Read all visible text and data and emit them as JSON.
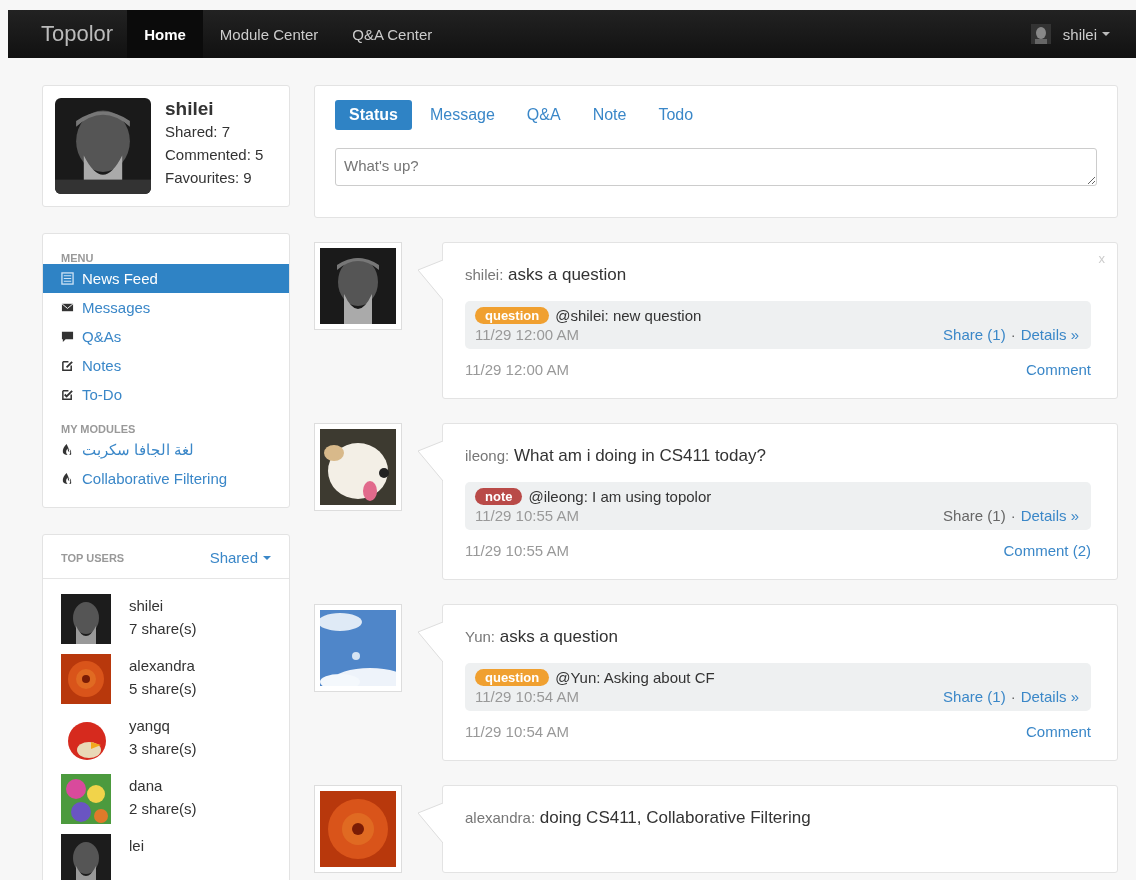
{
  "navbar": {
    "brand": "Topolor",
    "links": [
      {
        "label": "Home",
        "selected": true
      },
      {
        "label": "Module Center",
        "selected": false
      },
      {
        "label": "Q&A Center",
        "selected": false
      }
    ],
    "user": "shilei"
  },
  "profile": {
    "name": "shilei",
    "stats": [
      "Shared: 7",
      "Commented: 5",
      "Favourites: 9"
    ]
  },
  "menu": {
    "heading": "MENU",
    "items": [
      {
        "label": "News Feed",
        "selected": true
      },
      {
        "label": "Messages",
        "selected": false
      },
      {
        "label": "Q&As",
        "selected": false
      },
      {
        "label": "Notes",
        "selected": false
      },
      {
        "label": "To-Do",
        "selected": false
      }
    ],
    "modules_heading": "MY MODULES",
    "modules": [
      {
        "label": "لغة الجافا سكربت"
      },
      {
        "label": "Collaborative Filtering"
      }
    ]
  },
  "top_users": {
    "heading": "TOP USERS",
    "sort": "Shared",
    "users": [
      {
        "name": "shilei",
        "count": "7 share(s)"
      },
      {
        "name": "alexandra",
        "count": "5 share(s)"
      },
      {
        "name": "yangq",
        "count": "3 share(s)"
      },
      {
        "name": "dana",
        "count": "2 share(s)"
      },
      {
        "name": "lei"
      }
    ]
  },
  "composer": {
    "tabs": [
      {
        "label": "Status",
        "selected": true
      },
      {
        "label": "Message",
        "selected": false
      },
      {
        "label": "Q&A",
        "selected": false
      },
      {
        "label": "Note",
        "selected": false
      },
      {
        "label": "Todo",
        "selected": false
      }
    ],
    "placeholder": "What's up?"
  },
  "posts": [
    {
      "user": "shilei:",
      "text": "asks a question",
      "close": "x",
      "item": {
        "tag": "question",
        "color": "#f0a030",
        "text": "@shilei: new question",
        "time": "11/29 12:00 AM",
        "share": "Share (1)",
        "share_link": true,
        "separator": "·",
        "details": "Details »"
      },
      "time": "11/29 12:00 AM",
      "comment": "Comment"
    },
    {
      "user": "ileong:",
      "text": "What am i doing in CS411 today?",
      "item": {
        "tag": "note",
        "color": "#b94a48",
        "text": "@ileong: I am using topolor",
        "time": "11/29 10:55 AM",
        "share": "Share (1)",
        "share_link": false,
        "separator": "·",
        "details": "Details »"
      },
      "time": "11/29 10:55 AM",
      "comment": "Comment (2)"
    },
    {
      "user": "Yun:",
      "text": "asks a question",
      "item": {
        "tag": "question",
        "color": "#f0a030",
        "text": "@Yun: Asking about CF",
        "time": "11/29 10:54 AM",
        "share": "Share (1)",
        "share_link": true,
        "separator": "·",
        "details": "Details »"
      },
      "time": "11/29 10:54 AM",
      "comment": "Comment"
    },
    {
      "user": "alexandra:",
      "text": "doing CS411, Collaborative Filtering"
    }
  ]
}
